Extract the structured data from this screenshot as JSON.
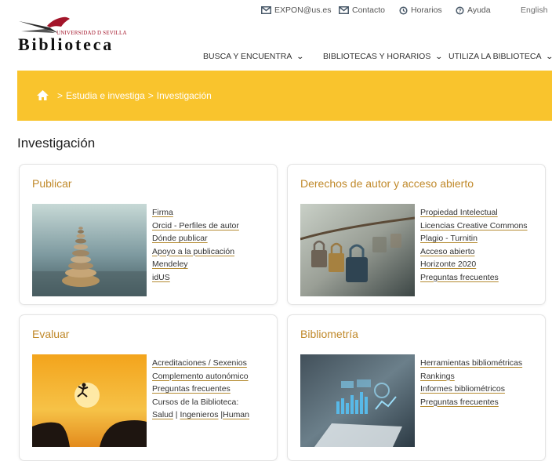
{
  "top": {
    "email": "EXPON@us.es",
    "contact": "Contacto",
    "hours": "Horarios",
    "help": "Ayuda",
    "lang": "English"
  },
  "logo": {
    "university": "UNIVERSIDAD D SEVILLA",
    "name": "Biblioteca"
  },
  "nav": [
    {
      "label": "BUSCA Y ENCUENTRA"
    },
    {
      "label": "BIBLIOTECAS Y HORARIOS"
    },
    {
      "label": "UTILIZA LA BIBLIOTECA"
    }
  ],
  "breadcrumb": {
    "items": [
      "Estudia e investiga",
      "Investigación"
    ],
    "separator": ">"
  },
  "page_title": "Investigación",
  "cards": [
    {
      "title": "Publicar",
      "links": [
        "Firma",
        "Orcid - Perfiles de autor",
        "Dónde publicar",
        "Apoyo a la publicación",
        "Mendeley",
        "idUS"
      ]
    },
    {
      "title": "Derechos de autor y acceso abierto",
      "links": [
        "Propiedad Intelectual",
        "Licencias Creative Commons",
        "Plagio - Turnitin",
        "Acceso abierto",
        "Horizonte 2020",
        "Preguntas frecuentes"
      ]
    },
    {
      "title": "Evaluar",
      "links": [
        "Acreditaciones / Sexenios",
        "Complemento autonómico",
        "Preguntas frecuentes"
      ],
      "courses_label": "Cursos de la Biblioteca:",
      "courses": [
        "Salud",
        "Ingenieros",
        "Human"
      ],
      "courses_sep": "|"
    },
    {
      "title": "Bibliometría",
      "links": [
        "Herramientas bibliométricas",
        "Rankings",
        "Informes bibliométricos",
        "Preguntas frecuentes"
      ]
    }
  ],
  "colors": {
    "banner": "#f9c42d",
    "card_title": "#c0892a",
    "brand_red": "#a3152a"
  },
  "icons": {
    "email": "envelope-icon",
    "contact": "envelope-icon",
    "hours": "clock-icon",
    "help": "help-icon",
    "home": "home-icon",
    "chevron": "chevron-down-icon"
  }
}
